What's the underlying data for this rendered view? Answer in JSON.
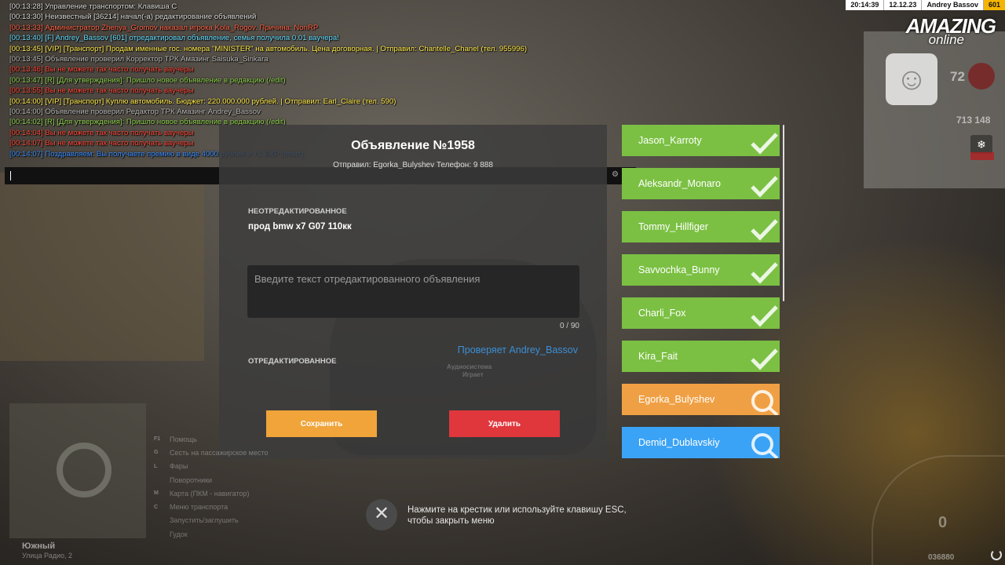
{
  "hud": {
    "time": "20:14:39",
    "date": "12.12.23",
    "player": "Andrey Bassov",
    "player_id": "601",
    "logo_main": "AMAZING",
    "logo_sub": "online",
    "health": "72",
    "money": "713 148",
    "snow_icon": "snowflake-icon"
  },
  "chat": {
    "lines": [
      {
        "text": "[00:13:28] Управление транспортом: Клавиша C",
        "color": "#d9d9d9"
      },
      {
        "text": "[00:13:30] Неизвестный [36214] начал(-а) редактирование объявлений",
        "color": "#d9d9d9"
      },
      {
        "text": "[00:13:33] Администратор Zhenya_Gromov наказал игрока Kola_Rogov. Причина: NonRP",
        "color": "#ff6347"
      },
      {
        "text": "[00:13:40] [F] Andrey_Bassov [601] отредактировал объявление, семья получила 0.01 ваучера!",
        "color": "#66ddff"
      },
      {
        "text": "[00:13:45] [VIP] [Транспорт] Продам именные гос. номера \"MINISTER\" на автомобиль. Цена договорная. | Отправил: Chantelle_Chanel (тел. 955996)",
        "color": "#ffe94a"
      },
      {
        "text": "[00:13:45] Объявление проверил Корректор ТРК Амазинг Saisuka_Sinkara",
        "color": "#b9b9b9"
      },
      {
        "text": "[00:13:46] Вы не можете так часто получать ваучеры",
        "color": "#ff4a3a"
      },
      {
        "text": "[00:13:47] [R] [Для утверждения]: Пришло новое объявление в редакцию (/edit)",
        "color": "#8fd14f"
      },
      {
        "text": "[00:13:55] Вы не можете так часто получать ваучеры",
        "color": "#ff4a3a"
      },
      {
        "text": "[00:14:00] [VIP] [Транспорт] Куплю автомобиль. Бюджет: 220.000.000 рублей. | Отправил: Earl_Claire (тел. 590)",
        "color": "#ffe94a"
      },
      {
        "text": "[00:14:00] Объявление проверил Редактор ТРК Амазинг Andrey_Bassov",
        "color": "#b9b9b9"
      },
      {
        "text": "[00:14:02] [R] [Для утверждения]: Пришло новое объявление в редакцию (/edit)",
        "color": "#8fd14f"
      },
      {
        "text": "[00:14:04] Вы не можете так часто получать ваучеры",
        "color": "#ff4a3a"
      },
      {
        "text": "[00:14:07] Вы не можете так часто получать ваучеры",
        "color": "#ff4a3a"
      },
      {
        "text": "[00:14:07] Поздравляем: Вы получаете премию в виде 4000 рублей и +1 EXP (опыт)",
        "color": "#3d8fff"
      }
    ],
    "input_value": "",
    "lang": "RU",
    "settings_icon": "gear-icon"
  },
  "modal": {
    "title": "Объявление №1958",
    "sender": "Отправил: Egorka_Bulyshev Телефон: 9 888",
    "orig_label": "НЕОТРЕДАКТИРОВАННОЕ",
    "orig_text": "прод bmw x7 G07 110кк",
    "edit_placeholder": "Введите текст отредактированного объявления",
    "edit_value": "",
    "counter": "0 / 90",
    "checker": "Проверяет Andrey_Bassov",
    "edited_label": "ОТРЕДАКТИРОВАННОЕ",
    "save_label": "Сохранить",
    "delete_label": "Удалить",
    "bg_audio": "Аудиосистема",
    "bg_playing": "Играет"
  },
  "reviewers": [
    {
      "name": "Jason_Karroty",
      "status": "done",
      "color": "#7bc043"
    },
    {
      "name": "Aleksandr_Monaro",
      "status": "done",
      "color": "#7bc043"
    },
    {
      "name": "Tommy_Hillfiger",
      "status": "done",
      "color": "#7bc043"
    },
    {
      "name": "Savvochka_Bunny",
      "status": "done",
      "color": "#7bc043"
    },
    {
      "name": "Charli_Fox",
      "status": "done",
      "color": "#7bc043"
    },
    {
      "name": "Kira_Fait",
      "status": "done",
      "color": "#7bc043"
    },
    {
      "name": "Egorka_Bulyshev",
      "status": "pending",
      "color": "#f0a044"
    },
    {
      "name": "Demid_Dublavskiy",
      "status": "pending",
      "color": "#3ba3f5"
    }
  ],
  "close_hint": {
    "line1": "Нажмите на крестик или используйте клавишу ESC,",
    "line2": "чтобы закрыть меню"
  },
  "keys": [
    {
      "key": "F1",
      "label": "Помощь"
    },
    {
      "key": "G",
      "label": "Сесть на пассажирское место"
    },
    {
      "key": "L",
      "label": "Фары"
    },
    {
      "key": "",
      "label": "Поворотники"
    },
    {
      "key": "M",
      "label": "Карта (ПКМ - навигатор)"
    },
    {
      "key": "C",
      "label": "Меню транспорта"
    },
    {
      "key": "",
      "label": "Запустить/заглушить"
    },
    {
      "key": "",
      "label": "Гудок"
    }
  ],
  "minimap": {
    "zone": "Южный",
    "street": "Улица Радио, 2"
  },
  "speedometer": {
    "speed": "0",
    "odometer": "036880"
  }
}
